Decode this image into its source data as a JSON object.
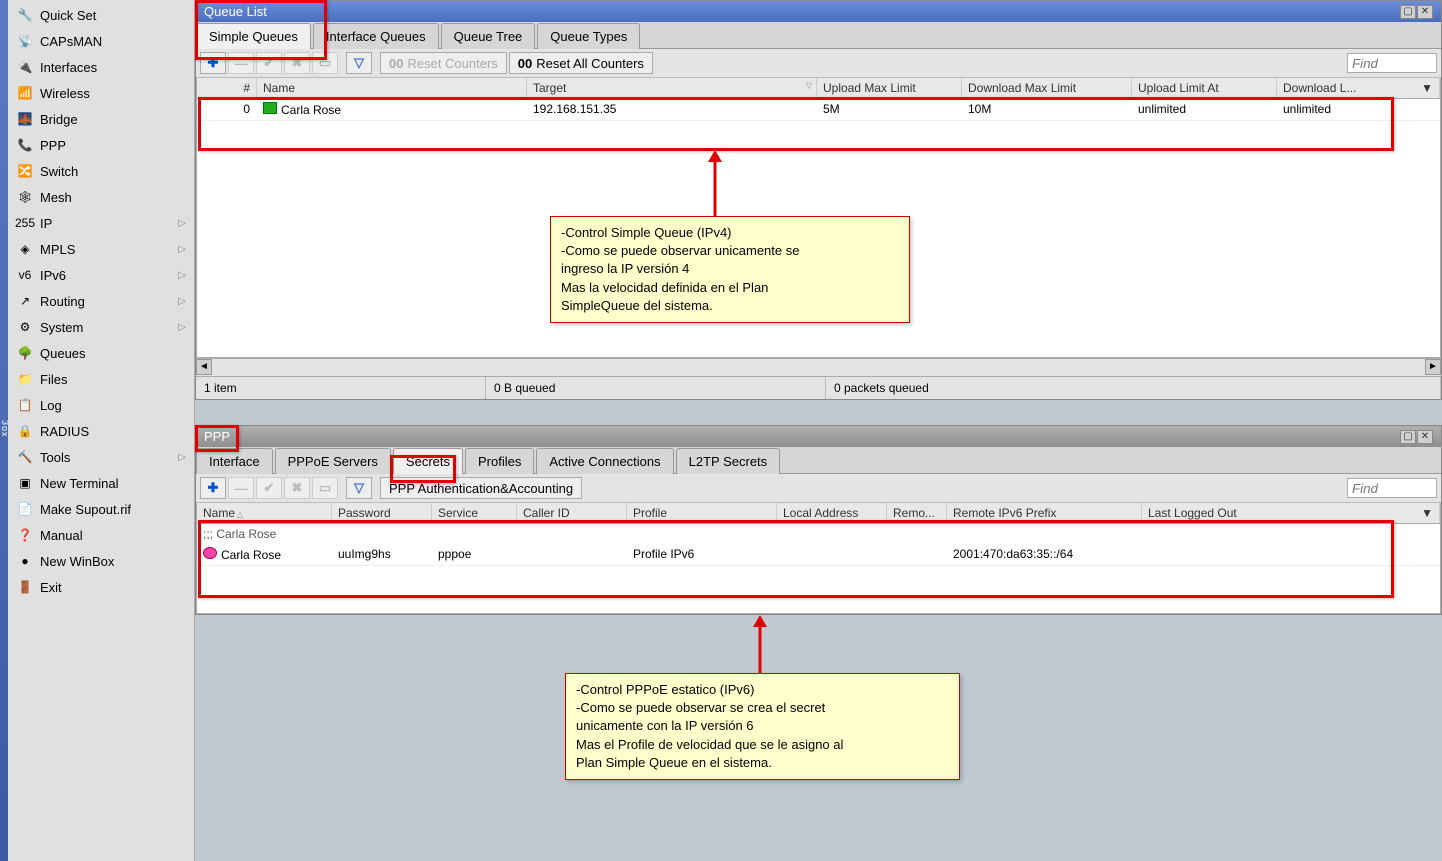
{
  "sidebar": {
    "items": [
      {
        "label": "Quick Set",
        "icon": "🔧",
        "arrow": false
      },
      {
        "label": "CAPsMAN",
        "icon": "📡",
        "arrow": false
      },
      {
        "label": "Interfaces",
        "icon": "🔌",
        "arrow": false
      },
      {
        "label": "Wireless",
        "icon": "📶",
        "arrow": false
      },
      {
        "label": "Bridge",
        "icon": "🌉",
        "arrow": false
      },
      {
        "label": "PPP",
        "icon": "📞",
        "arrow": false
      },
      {
        "label": "Switch",
        "icon": "🔀",
        "arrow": false
      },
      {
        "label": "Mesh",
        "icon": "🕸",
        "arrow": false
      },
      {
        "label": "IP",
        "icon": "255",
        "arrow": true
      },
      {
        "label": "MPLS",
        "icon": "◈",
        "arrow": true
      },
      {
        "label": "IPv6",
        "icon": "v6",
        "arrow": true
      },
      {
        "label": "Routing",
        "icon": "↗",
        "arrow": true
      },
      {
        "label": "System",
        "icon": "⚙",
        "arrow": true
      },
      {
        "label": "Queues",
        "icon": "🌳",
        "arrow": false
      },
      {
        "label": "Files",
        "icon": "📁",
        "arrow": false
      },
      {
        "label": "Log",
        "icon": "📋",
        "arrow": false
      },
      {
        "label": "RADIUS",
        "icon": "🔒",
        "arrow": false
      },
      {
        "label": "Tools",
        "icon": "🔨",
        "arrow": true
      },
      {
        "label": "New Terminal",
        "icon": "▣",
        "arrow": false
      },
      {
        "label": "Make Supout.rif",
        "icon": "📄",
        "arrow": false
      },
      {
        "label": "Manual",
        "icon": "❓",
        "arrow": false
      },
      {
        "label": "New WinBox",
        "icon": "●",
        "arrow": false
      },
      {
        "label": "Exit",
        "icon": "🚪",
        "arrow": false
      }
    ]
  },
  "queue_window": {
    "title": "Queue List",
    "tabs": [
      "Simple Queues",
      "Interface Queues",
      "Queue Tree",
      "Queue Types"
    ],
    "active_tab": 0,
    "toolbar": {
      "reset_counters": "Reset Counters",
      "reset_all": "Reset All Counters"
    },
    "find_placeholder": "Find",
    "columns": [
      "#",
      "Name",
      "Target",
      "Upload Max Limit",
      "Download Max Limit",
      "Upload Limit At",
      "Download L..."
    ],
    "rows": [
      {
        "num": "0",
        "name": "Carla Rose",
        "target": "192.168.151.35",
        "upmax": "5M",
        "dnmax": "10M",
        "uplimat": "unlimited",
        "dllim": "unlimited"
      }
    ],
    "status": {
      "items": "1 item",
      "queued_bytes": "0 B queued",
      "queued_packets": "0 packets queued"
    }
  },
  "ppp_window": {
    "title": "PPP",
    "tabs": [
      "Interface",
      "PPPoE Servers",
      "Secrets",
      "Profiles",
      "Active Connections",
      "L2TP Secrets"
    ],
    "active_tab": 2,
    "toolbar": {
      "auth": "PPP Authentication&Accounting"
    },
    "find_placeholder": "Find",
    "columns": [
      "Name",
      "Password",
      "Service",
      "Caller ID",
      "Profile",
      "Local Address",
      "Remo...",
      "Remote IPv6 Prefix",
      "Last Logged Out"
    ],
    "comment": ";;; Carla Rose",
    "rows": [
      {
        "name": "Carla Rose",
        "password": "uuImg9hs",
        "service": "pppoe",
        "caller": "",
        "profile": "Profile IPv6",
        "local": "",
        "remo": "",
        "ipv6": "2001:470:da63:35::/64",
        "logged": ""
      }
    ]
  },
  "annot1": {
    "l1": "-Control Simple Queue (IPv4)",
    "l2": "-Como se puede observar unicamente se",
    "l3": " ingreso la IP versión 4",
    "l4": " Mas la velocidad definida en el Plan",
    "l5": " SimpleQueue del sistema."
  },
  "annot2": {
    "l1": "-Control PPPoE estatico (IPv6)",
    "l2": "-Como se puede observar se crea el secret",
    "l3": " unicamente con la IP versión 6",
    "l4": " Mas el Profile de velocidad que se le asigno al",
    "l5": " Plan Simple Queue en el sistema."
  },
  "oo_label": "00"
}
